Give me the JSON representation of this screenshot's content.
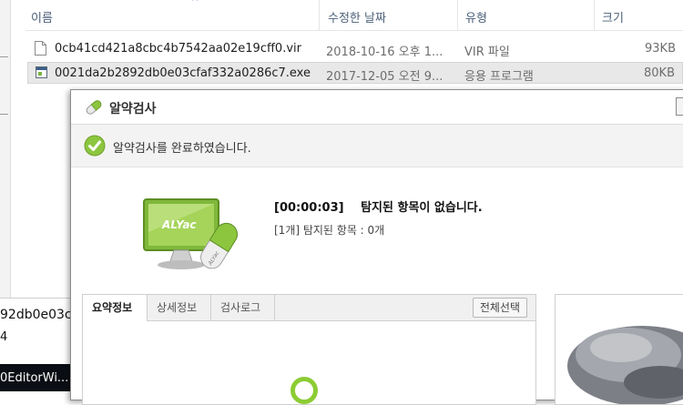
{
  "explorer": {
    "columns": [
      "이름",
      "수정한 날짜",
      "유형",
      "크기"
    ],
    "files": [
      {
        "name": "0cb41cd421a8cbc4b7542aa02e19cff0.vir",
        "date": "2018-10-16 오후 1...",
        "type": "VIR 파일",
        "size": "93KB",
        "icon": "blank-file-icon"
      },
      {
        "name": "0021da2b2892db0e03cfaf332a0286c7.exe",
        "date": "2017-12-05 오전 9...",
        "type": "응용 프로그램",
        "size": "80KB",
        "icon": "exe-file-icon"
      }
    ],
    "fragment_text": "92db0e03c",
    "fragment_small": "4",
    "taskbar_text": "0EditorWi..."
  },
  "dialog": {
    "title": "알약검사",
    "status_message": "알약검사를 완료하였습니다.",
    "result_time": "[00:00:03]",
    "result_headline": "탐지된 항목이 없습니다.",
    "result_detail": "[1개] 탐지된 항목 : 0개",
    "tabs": [
      "요약정보",
      "상세정보",
      "검사로그"
    ],
    "active_tab": "요약정보",
    "select_all_button": "전체선택",
    "logo_text": "ALYac",
    "pill_text": "ALYac"
  },
  "colors": {
    "brand_green": "#8cc63f",
    "header_text": "#4c607a"
  }
}
